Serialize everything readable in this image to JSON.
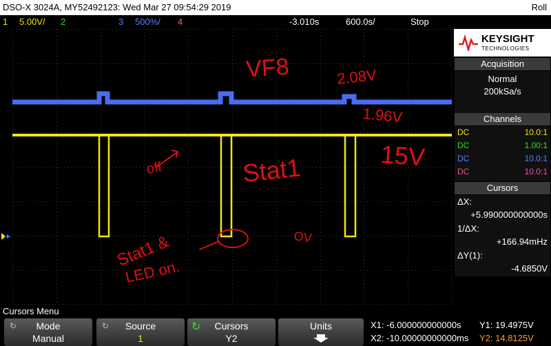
{
  "title_bar": {
    "text": "DSO-X 3024A, MY52492123: Wed Mar 27 09:54:29 2019",
    "mode": "Roll"
  },
  "channel_bar": {
    "ch1_label": "1",
    "ch1_scale": "5.00V/",
    "ch2_label": "2",
    "ch3_label": "3",
    "ch3_scale": "500%/",
    "ch4_label": "4",
    "time_delay": "-3.010s",
    "time_scale": "600.0s/",
    "run_state": "Stop"
  },
  "annotations": {
    "vf8": "VF8",
    "v208": "2.08V",
    "v196": "1.96V",
    "v15": "15V",
    "off": "off",
    "stat1": "Stat1",
    "ov": "OV",
    "stat1_led": "Stat1 &",
    "led_on": "LED on."
  },
  "brand": {
    "name": "KEYSIGHT",
    "sub": "TECHNOLOGIES",
    "color": "#d81e28"
  },
  "acquisition": {
    "header": "Acquisition",
    "mode": "Normal",
    "rate": "200kSa/s"
  },
  "channels": {
    "header": "Channels",
    "rows": [
      {
        "coupling": "DC",
        "probe": "10.0:1",
        "color": "#f5e60a"
      },
      {
        "coupling": "DC",
        "probe": "1.00:1",
        "color": "#29e02b"
      },
      {
        "coupling": "DC",
        "probe": "10.0:1",
        "color": "#5b7dff"
      },
      {
        "coupling": "DC",
        "probe": "10.0:1",
        "color": "#ff4fa0"
      }
    ]
  },
  "cursors_panel": {
    "header": "Cursors",
    "dx_label": "ΔX:",
    "dx_value": "+5.990000000000s",
    "inv_dx_label": "1/ΔX:",
    "inv_dx_value": "+166.94mHz",
    "dy_label": "ΔY(1):",
    "dy_value": "-4.6850V"
  },
  "menu": {
    "title": "Cursors Menu",
    "keys": [
      {
        "top": "Mode",
        "bottom": "Manual"
      },
      {
        "top": "Source",
        "bottom": "1"
      },
      {
        "top": "Cursors",
        "bottom": "Y2"
      },
      {
        "top": "Units",
        "bottom": ""
      }
    ]
  },
  "readout": {
    "x1": "X1: -6.000000000000s",
    "x2": "X2: -10.00000000000ms",
    "y1": "Y1: 19.4975V",
    "y2": "Y2: 14.8125V"
  },
  "colors": {
    "ch1": "#f5e60a",
    "ch3": "#4a6cf0",
    "annotation": "#e01010",
    "grid": "#3a3a3a"
  }
}
